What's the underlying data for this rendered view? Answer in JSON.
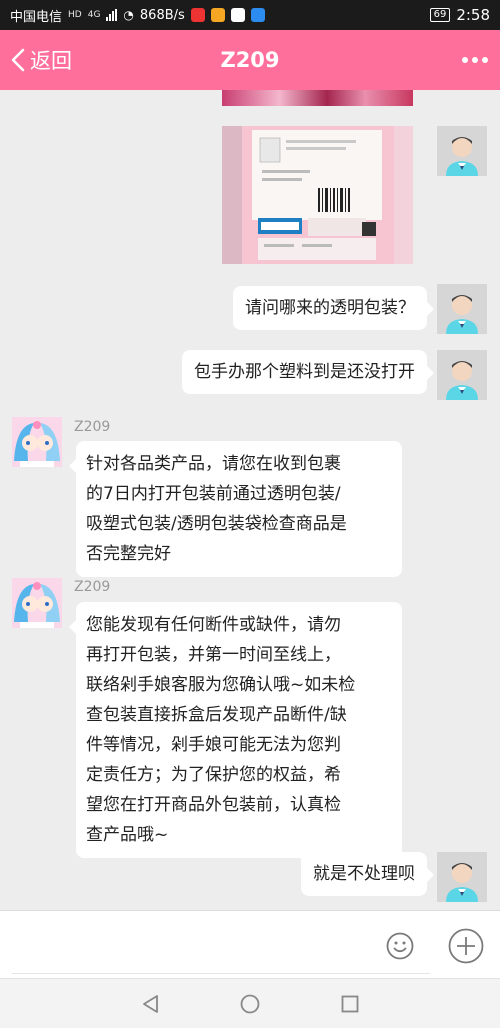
{
  "status_bar": {
    "carrier": "中国电信",
    "hd": "HD",
    "net_type": "4G",
    "speed": "868B/s",
    "battery": "69",
    "time": "2:58"
  },
  "header": {
    "back_label": "返回",
    "title": "Z209",
    "accent_color": "#ff6f9c",
    "more_icon": "more-dots-icon"
  },
  "messages": [
    {
      "side": "right",
      "type": "image",
      "content": "product-box-photo"
    },
    {
      "side": "right",
      "type": "text",
      "text": "请问哪来的透明包装？"
    },
    {
      "side": "right",
      "type": "text",
      "text": "包手办那个塑料到是还没打开"
    },
    {
      "side": "left",
      "type": "text",
      "sender": "Z209",
      "lines": [
        "针对各品类产品，请您在收到包裹",
        "的7日内打开包装前通过透明包装/",
        "吸塑式包装/透明包装袋检查商品是",
        "否完整完好"
      ]
    },
    {
      "side": "left",
      "type": "text",
      "sender": "Z209",
      "lines": [
        "您能发现有任何断件或缺件，请勿",
        "再打开包装，并第一时间至线上，",
        "联络剁手娘客服为您确认哦~如未检",
        "查包装直接拆盒后发现产品断件/缺",
        "件等情况，剁手娘可能无法为您判",
        "定责任方；为了保护您的权益，希",
        "望您在打开商品外包装前，认真检",
        "查产品哦~"
      ]
    },
    {
      "side": "right",
      "type": "text",
      "text": "就是不处理呗"
    }
  ],
  "input_bar": {
    "placeholder": "",
    "emoji_icon": "emoji-icon",
    "plus_icon": "plus-icon"
  },
  "nav_bar": {
    "icons": [
      "back-triangle-icon",
      "home-circle-icon",
      "recents-square-icon"
    ]
  }
}
